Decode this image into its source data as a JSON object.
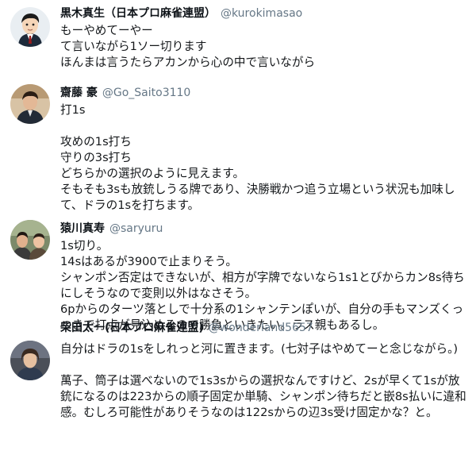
{
  "tweets": [
    {
      "name": "黒木真生（日本プロ麻雀連盟）",
      "handle": "@kurokimasao",
      "avatar_icon": "avatar-cartoon-man-icon",
      "text": "もーやめてーやー\nて言いながら1ソー切ります\nほんまは言うたらアカンから心の中で言いながら"
    },
    {
      "name": "齋藤 豪",
      "handle": "@Go_Saito3110",
      "avatar_icon": "avatar-photo-man-icon",
      "text": "打1s\n\n攻めの1s打ち\n守りの3s打ち\nどちらかの選択のように見えます。\nそもそも3sも放銃しうる牌であり、決勝戦かつ追う立場という状況も加味して、ドラの1sを打ちます。"
    },
    {
      "name": "猿川真寿",
      "handle": "@saryuru",
      "avatar_icon": "avatar-photo-group-icon",
      "text": "1s切り。\n14sはあるが3900で止まりそう。\nシャンポン否定はできないが、相方が字牌でないなら1s1とびからカン8s待ちにしそうなので変則以外はなさそう。\n6pからのターツ落としで十分系の1シャンテンぽいが、自分の手もマンズくっつきで打点が見込めるので勝負といきたい。ラス親もあるし。"
    },
    {
      "name": "柴田太一(日本プロ麻雀連盟)",
      "handle": "@wonderland5657",
      "avatar_icon": "avatar-photo-woman-icon",
      "text": "自分はドラの1sをしれっと河に置きます。(七対子はやめてーと念じながら。)\n\n萬子、筒子は選べないので1s3sからの選択なんですけど、2sが早くて1sが放銃になるのは223からの順子固定か単騎、シャンポン待ちだと嵌8s払いに違和感。むしろ可能性がありそうなのは122sからの辺3s受け固定かな？と。"
    }
  ],
  "colors": {
    "name": "#0f1419",
    "handle": "#657786",
    "text": "#14171a",
    "background": "#ffffff"
  }
}
